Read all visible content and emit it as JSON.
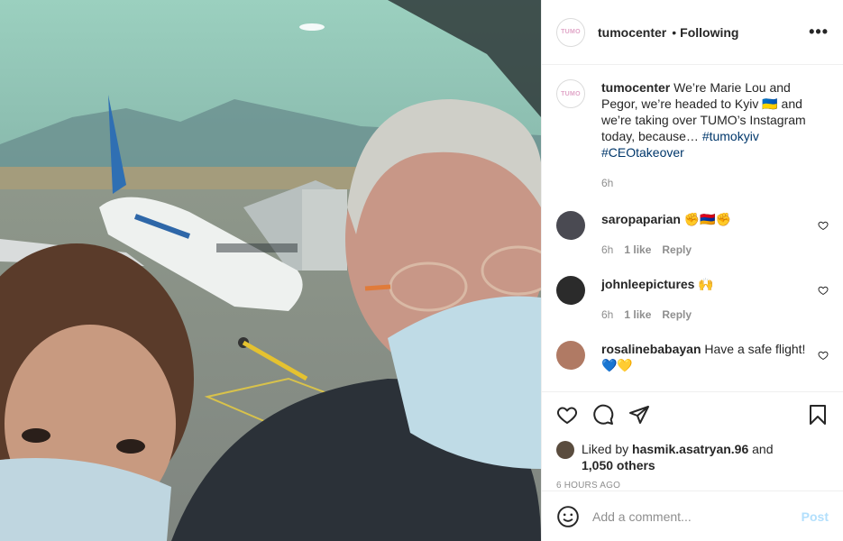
{
  "post": {
    "author": "tumocenter",
    "follow_status": "Following",
    "separator": "•",
    "more_icon": "more-horizontal-icon",
    "logo_text": "TUMO"
  },
  "caption": {
    "username": "tumocenter",
    "text": " We’re Marie Lou and Pegor, we’re headed to Kyiv 🇺🇦 and we’re taking over TUMO’s Instagram today, because… ",
    "tag1": "#tumokyiv",
    "tag2": "#CEOtakeover",
    "time": "6h"
  },
  "comments": [
    {
      "username": "saropaparian",
      "text": " ✊🇦🇲✊",
      "time": "6h",
      "likes": "1 like",
      "reply": "Reply",
      "avatar_color": "#4a4a52"
    },
    {
      "username": "johnleepictures",
      "text": " 🙌",
      "time": "6h",
      "likes": "1 like",
      "reply": "Reply",
      "avatar_color": "#2b2b2b"
    },
    {
      "username": "rosalinebabayan",
      "text": " Have a safe flight! 💙💛",
      "avatar_color": "#b07a64"
    }
  ],
  "actions": {
    "icons": [
      "heart-icon",
      "comment-icon",
      "share-icon",
      "bookmark-icon"
    ],
    "liked_by_prefix": "Liked by ",
    "liked_by_user": "hasmik.asatryan.96",
    "liked_by_mid": " and",
    "liked_by_others": "1,050 others",
    "timestamp": "6 HOURS AGO"
  },
  "add_comment": {
    "placeholder": "Add a comment...",
    "post_label": "Post"
  },
  "colors": {
    "link": "#00376b",
    "muted": "#8e8e8e",
    "post_disabled": "#b2dffc"
  }
}
